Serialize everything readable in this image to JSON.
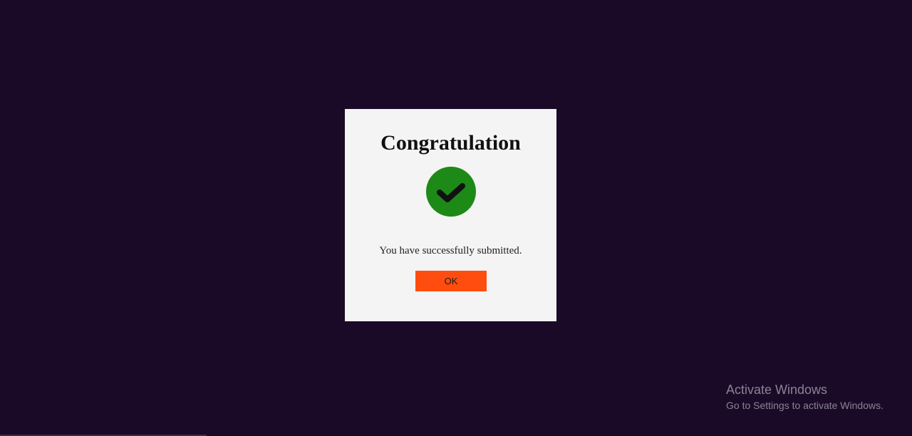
{
  "dialog": {
    "title": "Congratulation",
    "icon": "check-circle-icon",
    "message": "You have successfully submitted.",
    "ok_label": "OK"
  },
  "watermark": {
    "title": "Activate Windows",
    "subtitle": "Go to Settings to activate Windows."
  },
  "colors": {
    "background": "#1a0a27",
    "dialog_background": "#f4f4f4",
    "success_green": "#1d8a17",
    "button_accent": "#ff4d0f"
  }
}
